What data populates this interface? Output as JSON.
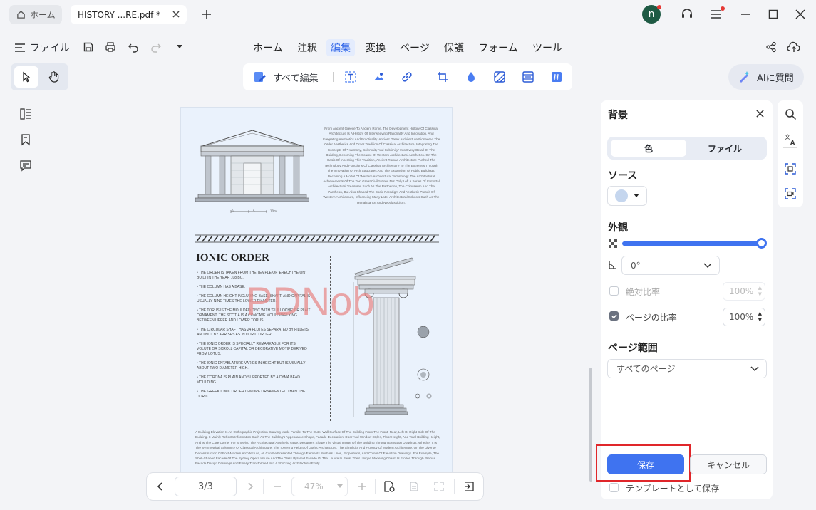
{
  "tabs": {
    "home": "ホーム",
    "doc": "HISTORY ...RE.pdf *"
  },
  "avatar_letter": "n",
  "menu": {
    "file": "ファイル",
    "items": [
      "ホーム",
      "注釈",
      "編集",
      "変換",
      "ページ",
      "保護",
      "フォーム",
      "ツール"
    ],
    "active": "編集"
  },
  "toolbar": {
    "edit_all": "すべて編集"
  },
  "ai_button": "AIに質問",
  "document": {
    "heading": "IONIC ORDER",
    "intro": "From Ancient Greece To Ancient Rome, The Development History Of Classical Architecture Is A History Of Interweaving Rationality And Innovation, And Integrating Aesthetics And Practicality. Ancient Greek Architecture Pioneered The Order Aesthetics And Order Tradition Of Classical Architecture, Integrating The Concepts Of \"Harmony, Solemnity And Sublimity\" Into Every Detail Of The Building, Becoming The Source Of Western Architectural Aesthetics. On The Basis Of Inheriting This Tradition, Ancient Roman Architecture Pushed The Technology And Functions Of Classical Architecture To The Extremes Through The Innovation Of Arch Structures And The Expansion Of Public Buildings, Becoming A Model Of Western Architectural Technology. The Architectural Achievements Of The Two Great Civilizations Not Only Left A Series Of Immortal Architectural Treasures Such As The Parthenon, The Colosseum And The Pantheon, But Also Shaped The Basic Paradigm And Aesthetic Pursuit Of Western Architecture, Influencing Many Later Architectural Schools Such As The Renaissance And Neoclassicism.",
    "scale_labels": [
      "0",
      "5",
      "10m"
    ],
    "bullets": [
      "THE ORDER IS TAKEN FROM THE TEMPLE OF 'ERECHTHEION' BUILT IN THE YEAR 108 BC.",
      "THE COLUMN HAS A BASE.",
      "THE COLUMN HEIGHT INCLUDING BASE, SHAFT, AND CAPITAL IS USUALLY NINE TIMES THE LOWER DIAMETER.",
      "THE TORUS IS THE MOULDED DISC WITH 'GUILLOCHE' OR PLAIT ORNAMENT. THE SCOTIA IS A CONCAVE MOULDING LYING BETWEEN UPPER AND LOWER TORUS.",
      "THE CIRCULAR SHAFT HAS 24 FLUTES SEPARATED BY FILLETS AND NOT BY ARRISES AS IN DORIC ORDER.",
      "THE IONIC ORDER IS SPECIALLY REMARKABLE FOR ITS VOLUTE OR SCROLL CAPITAL OR DECORATIVE MOTIF DERIVED FROM LOTUS.",
      "THE IONIC ENTABLATURE VARIES IN HEIGHT BUT IS USUALLY ABOUT TWO DIAMETER HIGH.",
      "THE CORONA IS PLAIN AND SUPPORTED BY A CYMA BEAD MOULDING.",
      "THE GREEK IONIC ORDER IS MORE ORNAMENTED THAN THE DORIC."
    ],
    "footer": "A Building Elevation Is An Orthographic Projection Drawing Made Parallel To The Outer Wall Surface Of The Building From The Front, Rear, Left Or Right Side Of The Building. It Mainly Reflects Information Such As The Building's Appearance Shape, Facade Decoration, Door And Window Styles, Floor Height, And Total Building Height, And Is The Core Carrier For Showing The Architectural Aesthetic Value. Designers Shape The Visual Image Of The Building Through Elevation Drawings, Whether It Is The Symmetrical Solemnity Of Classical Architecture, The Towering Height Of Gothic Architecture, The Simplicity And Fluency Of Modern Architecture, Or The Diverse Deconstruction Of Post-Modern Architecture, All Can Be Presented Through Elements Such As Lines, Proportions, And Colors Of Elevation Drawings. For Example, The Shell-Shaped Facade Of The Sydney Opera House And The Glass Pyramid Facade Of The Louvre In Paris, Their Unique Modeling Charm Is Frozen Through Precise Facade Design Drawings And Finally Transformed Into A Shocking Architectural Entity.",
    "watermark": "PDNob"
  },
  "pager": {
    "page": "3/3",
    "zoom": "47%"
  },
  "panel": {
    "title": "背景",
    "seg_color": "色",
    "seg_file": "ファイル",
    "source_label": "ソース",
    "swatch_color": "#c5d6ee",
    "appearance_label": "外観",
    "opacity": 1.0,
    "rotation": "0°",
    "absolute_ratio": "絶対比率",
    "absolute_value": "100%",
    "page_ratio": "ページの比率",
    "page_ratio_value": "100%",
    "page_range_label": "ページ範囲",
    "page_range_value": "すべてのページ",
    "save": "保存",
    "cancel": "キャンセル",
    "save_template": "テンプレートとして保存"
  },
  "colors": {
    "accent": "#3f73f0",
    "highlight_box": "#e0262a",
    "badge": "#e53935"
  }
}
